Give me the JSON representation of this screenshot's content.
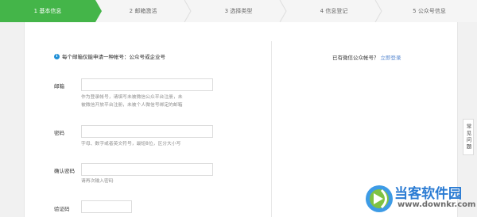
{
  "steps": [
    {
      "label": "1 基本信息",
      "active": true
    },
    {
      "label": "2 邮箱激活",
      "active": false
    },
    {
      "label": "3 选择类型",
      "active": false
    },
    {
      "label": "4 信息登记",
      "active": false
    },
    {
      "label": "5 公众号信息",
      "active": false
    }
  ],
  "form": {
    "notice": "每个邮箱仅能申请一种帐号：公众号或企业号",
    "email": {
      "label": "邮箱",
      "value": "",
      "hint_line1": "作为登录帐号，请填写未被微信公众平台注册，未",
      "hint_line2": "被微信开放平台注册，未被个人微信号绑定的邮箱"
    },
    "password": {
      "label": "密码",
      "value": "",
      "hint": "字母、数字或者英文符号，最短8位，区分大小写"
    },
    "confirm_password": {
      "label": "确认密码",
      "value": "",
      "hint": "请再次输入密码"
    },
    "captcha": {
      "label": "验证码",
      "value": ""
    }
  },
  "sidebar": {
    "question": "已有微信公众帐号？",
    "login_link": "立即登录"
  },
  "faq_button": "常见问题",
  "watermark": {
    "text": "当客软件园",
    "url": "www.downkr.com"
  },
  "colors": {
    "active_step": "#44b549",
    "link": "#5a8ad1",
    "info_icon": "#1f8fd6"
  }
}
